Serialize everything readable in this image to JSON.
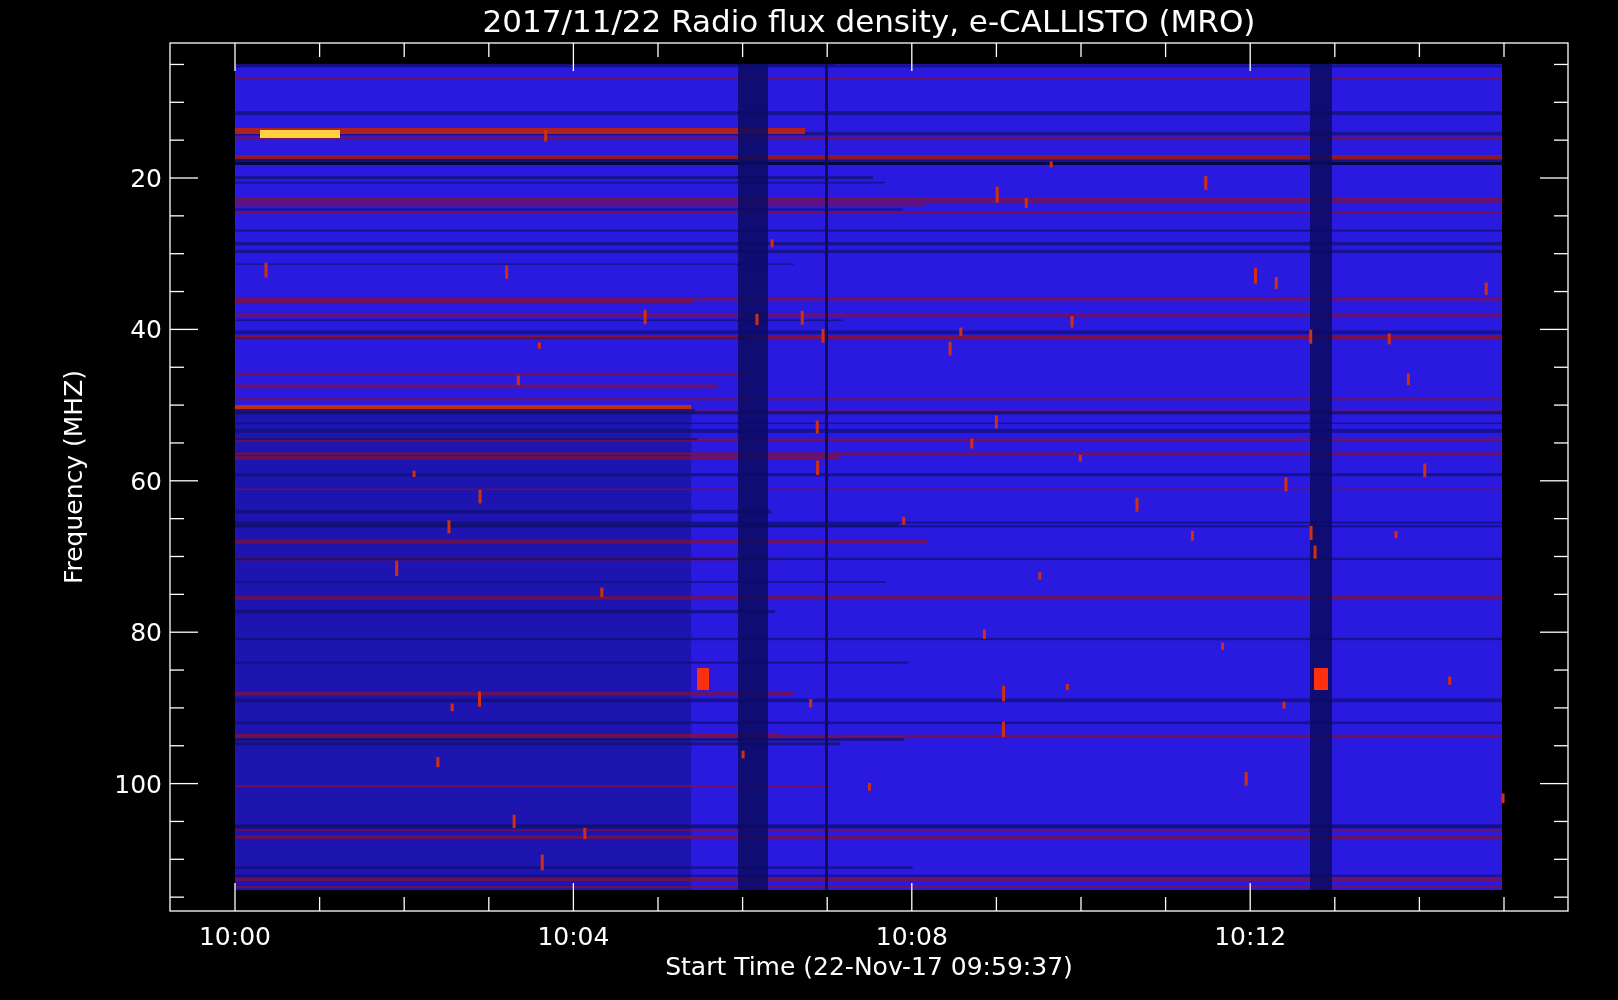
{
  "chart": {
    "title": "2017/11/22  Radio flux density, e-CALLISTO (MRO)",
    "ylabel": "Frequency (MHZ)",
    "xlabel": "Start Time (22-Nov-17 09:59:37)",
    "y_tick_labels": [
      "20",
      "40",
      "60",
      "80",
      "100"
    ],
    "x_tick_labels": [
      "10:00",
      "10:04",
      "10:08",
      "10:12"
    ]
  }
}
